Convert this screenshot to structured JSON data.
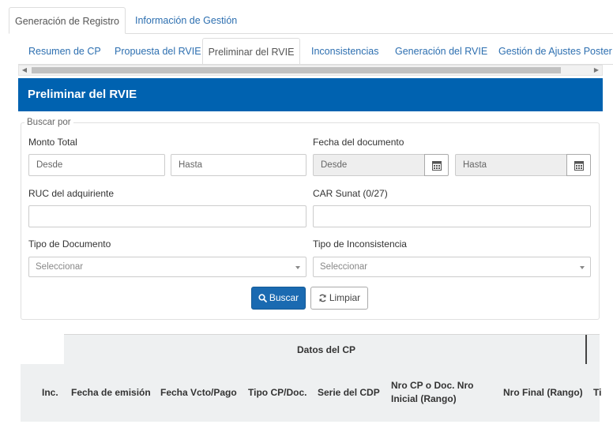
{
  "top_tabs": [
    {
      "label": "Generación de Registro",
      "active": true
    },
    {
      "label": "Información de Gestión",
      "active": false
    }
  ],
  "sub_tabs": [
    {
      "label": "Resumen de CP",
      "active": false
    },
    {
      "label": "Propuesta del RVIE",
      "active": false
    },
    {
      "label": "Preliminar del RVIE",
      "active": true
    },
    {
      "label": "Inconsistencias",
      "active": false
    },
    {
      "label": "Generación del RVIE",
      "active": false
    },
    {
      "label": "Gestión de Ajustes Poster",
      "active": false
    }
  ],
  "panel": {
    "title": "Preliminar del RVIE"
  },
  "search": {
    "legend": "Buscar por",
    "monto_total": {
      "label": "Monto Total",
      "desde_placeholder": "Desde",
      "hasta_placeholder": "Hasta"
    },
    "fecha_documento": {
      "label": "Fecha del documento",
      "desde_placeholder": "Desde",
      "hasta_placeholder": "Hasta"
    },
    "ruc": {
      "label": "RUC del adquiriente",
      "value": ""
    },
    "car": {
      "label": "CAR Sunat (0/27)",
      "value": ""
    },
    "tipo_documento": {
      "label": "Tipo de Documento",
      "selected": "Seleccionar"
    },
    "tipo_inconsistencia": {
      "label": "Tipo de Inconsistencia",
      "selected": "Seleccionar"
    },
    "buscar_label": "Buscar",
    "limpiar_label": "Limpiar"
  },
  "table": {
    "group_header": "Datos del CP",
    "columns": [
      "Inc.",
      "Fecha de emisión",
      "Fecha Vcto/Pago",
      "Tipo CP/Doc.",
      "Serie del CDP",
      "Nro CP o Doc. Nro Inicial (Rango)",
      "Nro Final (Rango)",
      "Ti"
    ]
  },
  "colors": {
    "primary": "#0062b0",
    "link": "#2d6fb0",
    "header_bg": "#eef0f1"
  }
}
